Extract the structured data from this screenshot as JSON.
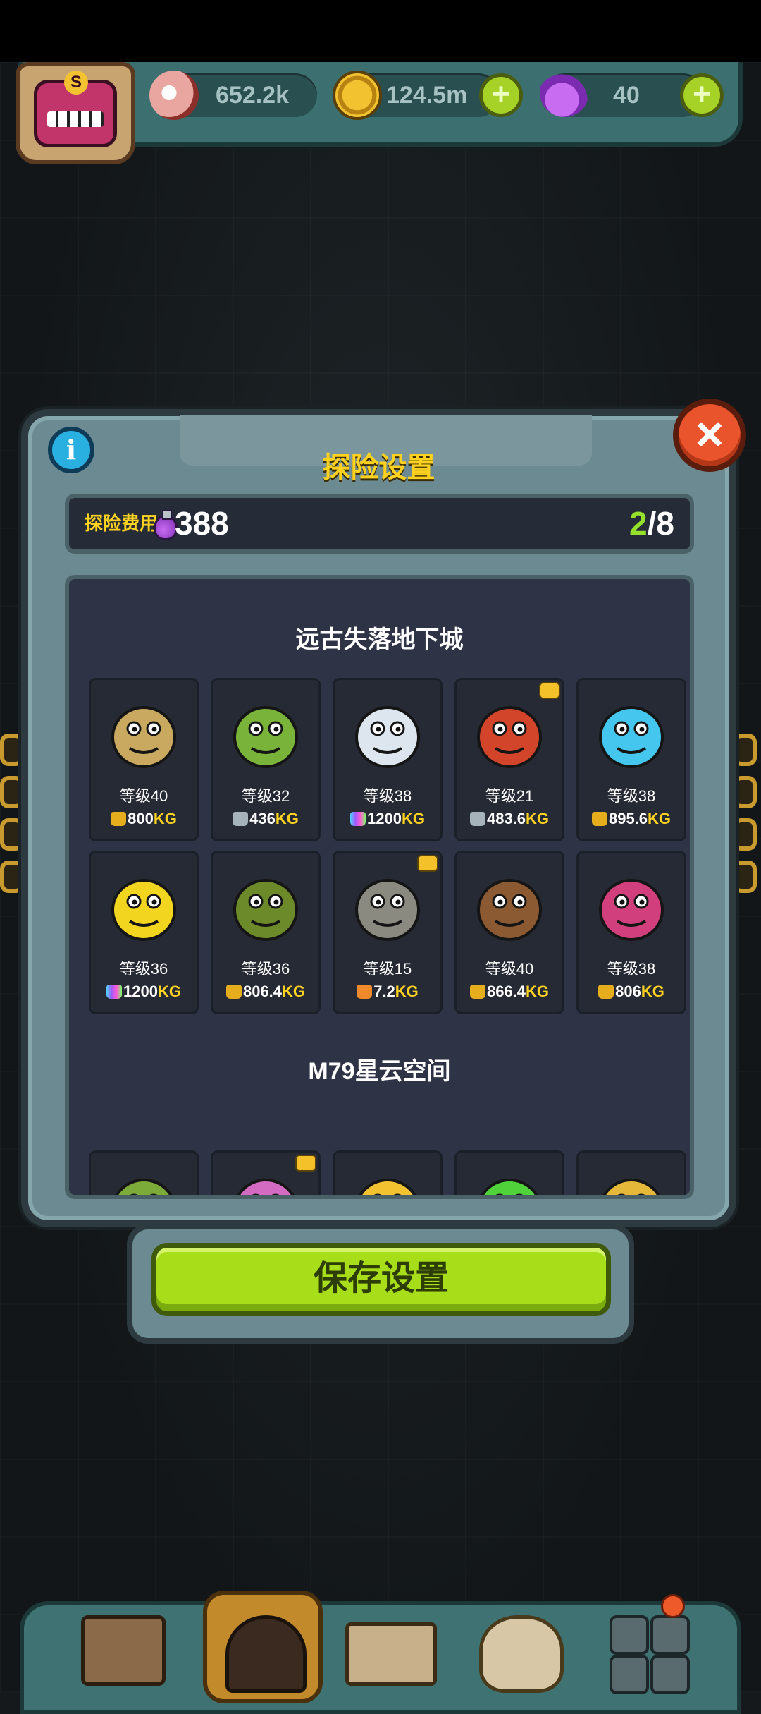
{
  "topbar": {
    "eyes": "652.2k",
    "coins": "124.5m",
    "potions": "40",
    "add_label": "+"
  },
  "modal": {
    "title": "探险设置",
    "info_label": "i",
    "close_label": "×",
    "cost_label": "探险费用",
    "cost_value": "388",
    "progress_current": "2",
    "progress_total": "/8",
    "sections": [
      {
        "title": "远古失落地下城",
        "monsters": [
          {
            "name": "voodoo-king",
            "level": "等级40",
            "weight": "800",
            "unit": "KG",
            "weight_tier": "gold",
            "badge": false,
            "color": "#c9a860"
          },
          {
            "name": "mandrake",
            "level": "等级32",
            "weight": "436",
            "unit": "KG",
            "weight_tier": "silver",
            "badge": false,
            "color": "#7ab33a"
          },
          {
            "name": "yeti",
            "level": "等级38",
            "weight": "1200",
            "unit": "KG",
            "weight_tier": "rainbow",
            "badge": false,
            "color": "#dde6ee"
          },
          {
            "name": "red-dino",
            "level": "等级21",
            "weight": "483.6",
            "unit": "KG",
            "weight_tier": "silver",
            "badge": true,
            "color": "#d2452a"
          },
          {
            "name": "blue-slime",
            "level": "等级38",
            "weight": "895.6",
            "unit": "KG",
            "weight_tier": "gold",
            "badge": false,
            "color": "#45c6ee"
          },
          {
            "name": "yellow-lizard",
            "level": "等级36",
            "weight": "1200",
            "unit": "KG",
            "weight_tier": "rainbow",
            "badge": false,
            "color": "#f2d51e"
          },
          {
            "name": "top-hat-plant",
            "level": "等级36",
            "weight": "806.4",
            "unit": "KG",
            "weight_tier": "gold",
            "badge": false,
            "color": "#6c8a2a"
          },
          {
            "name": "eyeball-cart",
            "level": "等级15",
            "weight": "7.2",
            "unit": "KG",
            "weight_tier": "orange",
            "badge": true,
            "color": "#8a8a80"
          },
          {
            "name": "bear-mummy",
            "level": "等级40",
            "weight": "866.4",
            "unit": "KG",
            "weight_tier": "gold",
            "badge": false,
            "color": "#8c5a32"
          },
          {
            "name": "croc-flower",
            "level": "等级38",
            "weight": "806",
            "unit": "KG",
            "weight_tier": "gold",
            "badge": false,
            "color": "#d13f7c"
          }
        ]
      },
      {
        "title": "M79星云空间",
        "monsters": [
          {
            "name": "melon-ball",
            "badge": false,
            "color": "#7cab3a"
          },
          {
            "name": "pink-hairball",
            "badge": true,
            "color": "#d36bc2"
          },
          {
            "name": "bee-fly",
            "badge": false,
            "color": "#f2c230"
          },
          {
            "name": "green-robot",
            "badge": false,
            "color": "#4fd23a"
          },
          {
            "name": "corn-cob",
            "badge": false,
            "color": "#e6b83a"
          }
        ]
      }
    ],
    "save_label": "保存设置"
  },
  "bottom_nav": [
    "shop",
    "dungeon",
    "book",
    "money-bag",
    "grid-menu"
  ]
}
